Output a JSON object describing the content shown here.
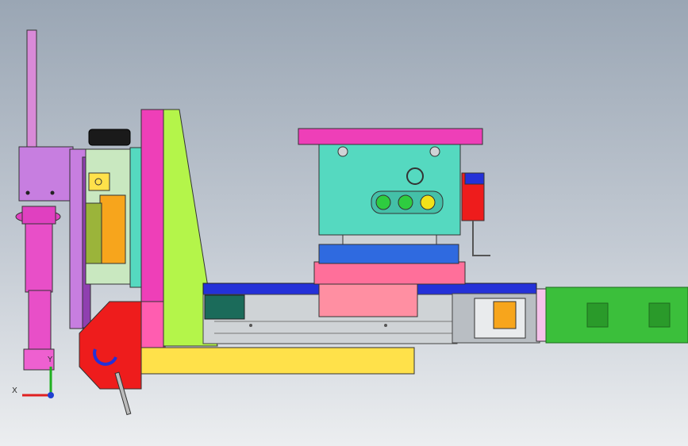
{
  "viewport": {
    "background_top": "#9aa6b4",
    "background_bottom": "#eceef0"
  },
  "triad": {
    "x_label": "X",
    "y_label": "Y",
    "x_color": "#e02020",
    "y_color": "#20b020",
    "z_color": "#2040d0"
  },
  "colors": {
    "rod": "#d98ad8",
    "magenta_cylinder": "#e040c0",
    "lavender_block": "#c77ee0",
    "hot_pink_plate": "#ee3fb8",
    "lime_wedge": "#b4f54a",
    "yellow_base": "#ffe14a",
    "red_bracket": "#ee1c1c",
    "blue_rail": "#2431d8",
    "pink_slide": "#ff8fa2",
    "light_pink_plate": "#ff6f9a",
    "teal_housing": "#55d9c0",
    "rail_grey": "#cfd3d6",
    "motor_green": "#3bbf3b",
    "orange_sensor": "#f7a51c",
    "dark_teal": "#1b6b5a"
  },
  "indicator_lights": [
    "#2ecc40",
    "#2ecc40",
    "#f1e21a"
  ]
}
